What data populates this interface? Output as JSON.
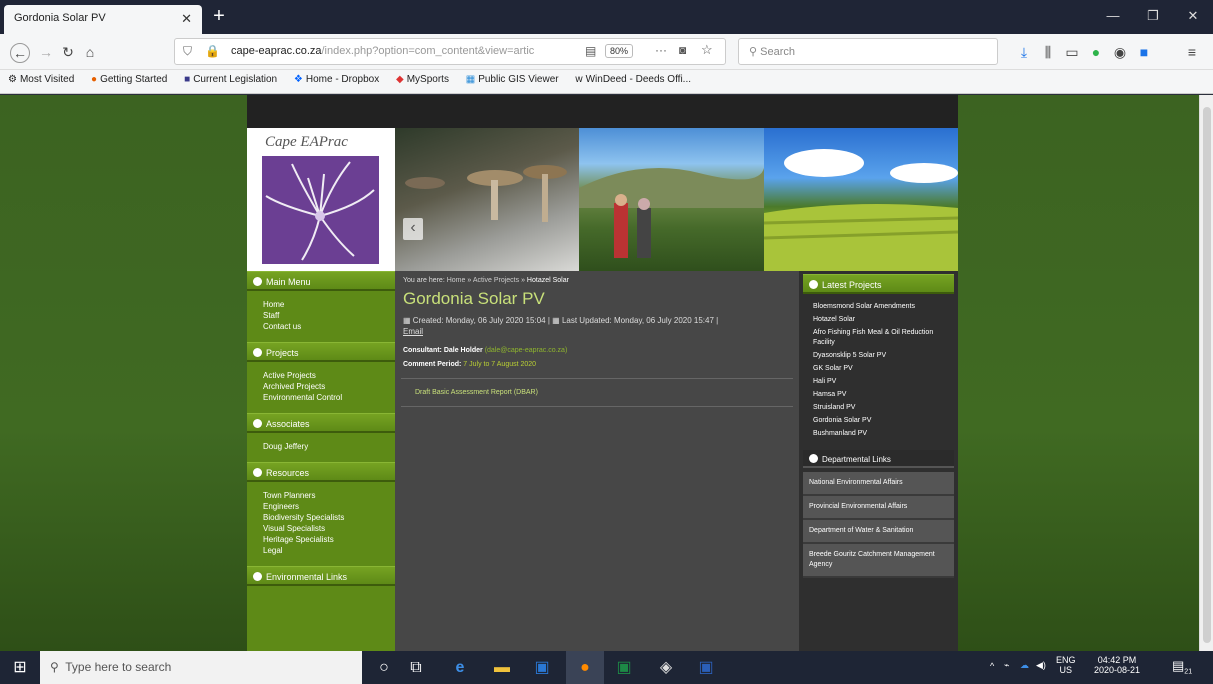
{
  "browser": {
    "tab_title": "Gordonia Solar PV",
    "url_domain": "cape-eaprac.co.za",
    "url_path": "/index.php?option=com_content&view=artic",
    "zoom": "80%",
    "search_placeholder": "Search"
  },
  "bookmarks": [
    "Most Visited",
    "Getting Started",
    "Current Legislation",
    "Home - Dropbox",
    "MySports",
    "Public GIS Viewer",
    "WinDeed - Deeds Offi..."
  ],
  "site": {
    "logo_text": "Cape EAPrac",
    "left_menu": [
      {
        "heading": "Main Menu",
        "items": [
          "Home",
          "Staff",
          "Contact us"
        ]
      },
      {
        "heading": "Projects",
        "items": [
          "Active Projects",
          "Archived Projects",
          "Environmental Control"
        ]
      },
      {
        "heading": "Associates",
        "items": [
          "Doug Jeffery"
        ]
      },
      {
        "heading": "Resources",
        "items": [
          "Town Planners",
          "Engineers",
          "Biodiversity Specialists",
          "Visual Specialists",
          "Heritage Specialists",
          "Legal"
        ]
      },
      {
        "heading": "Environmental Links",
        "items": []
      }
    ],
    "breadcrumb": {
      "prefix": "You are here:",
      "items": [
        "Home",
        "Active Projects",
        "Hotazel Solar"
      ]
    },
    "article": {
      "title": "Gordonia Solar PV",
      "created": "Created: Monday, 06 July 2020 15:04",
      "updated": "Last Updated: Monday, 06 July 2020 15:47",
      "email": "Email",
      "consultant_label": "Consultant: Dale Holder",
      "consultant_email": "(dale@cape-eaprac.co.za)",
      "comment_label": "Comment Period:",
      "comment_value": "7 July to 7 August 2020",
      "document": "Draft Basic Assessment Report (DBAR)"
    },
    "latest_projects": {
      "heading": "Latest Projects",
      "items": [
        "Bloemsmond Solar Amendments",
        "Hotazel Solar",
        "Afro Fishing Fish Meal & Oil Reduction Facility",
        "Dyasonsklip 5 Solar PV",
        "GK Solar PV",
        "Hali PV",
        "Hamsa PV",
        "Struisland PV",
        "Gordonia Solar PV",
        "Bushmanland PV"
      ]
    },
    "departmental_links": {
      "heading": "Departmental Links",
      "items": [
        "National Environmental Affairs",
        "Provincial Environmental Affairs",
        "Department of Water & Sanitation",
        "Breede Gouritz Catchment Management Agency"
      ]
    }
  },
  "taskbar": {
    "search_placeholder": "Type here to search",
    "lang_top": "ENG",
    "lang_bottom": "US",
    "time": "04:42 PM",
    "date": "2020-08-21",
    "notifications": "21"
  }
}
